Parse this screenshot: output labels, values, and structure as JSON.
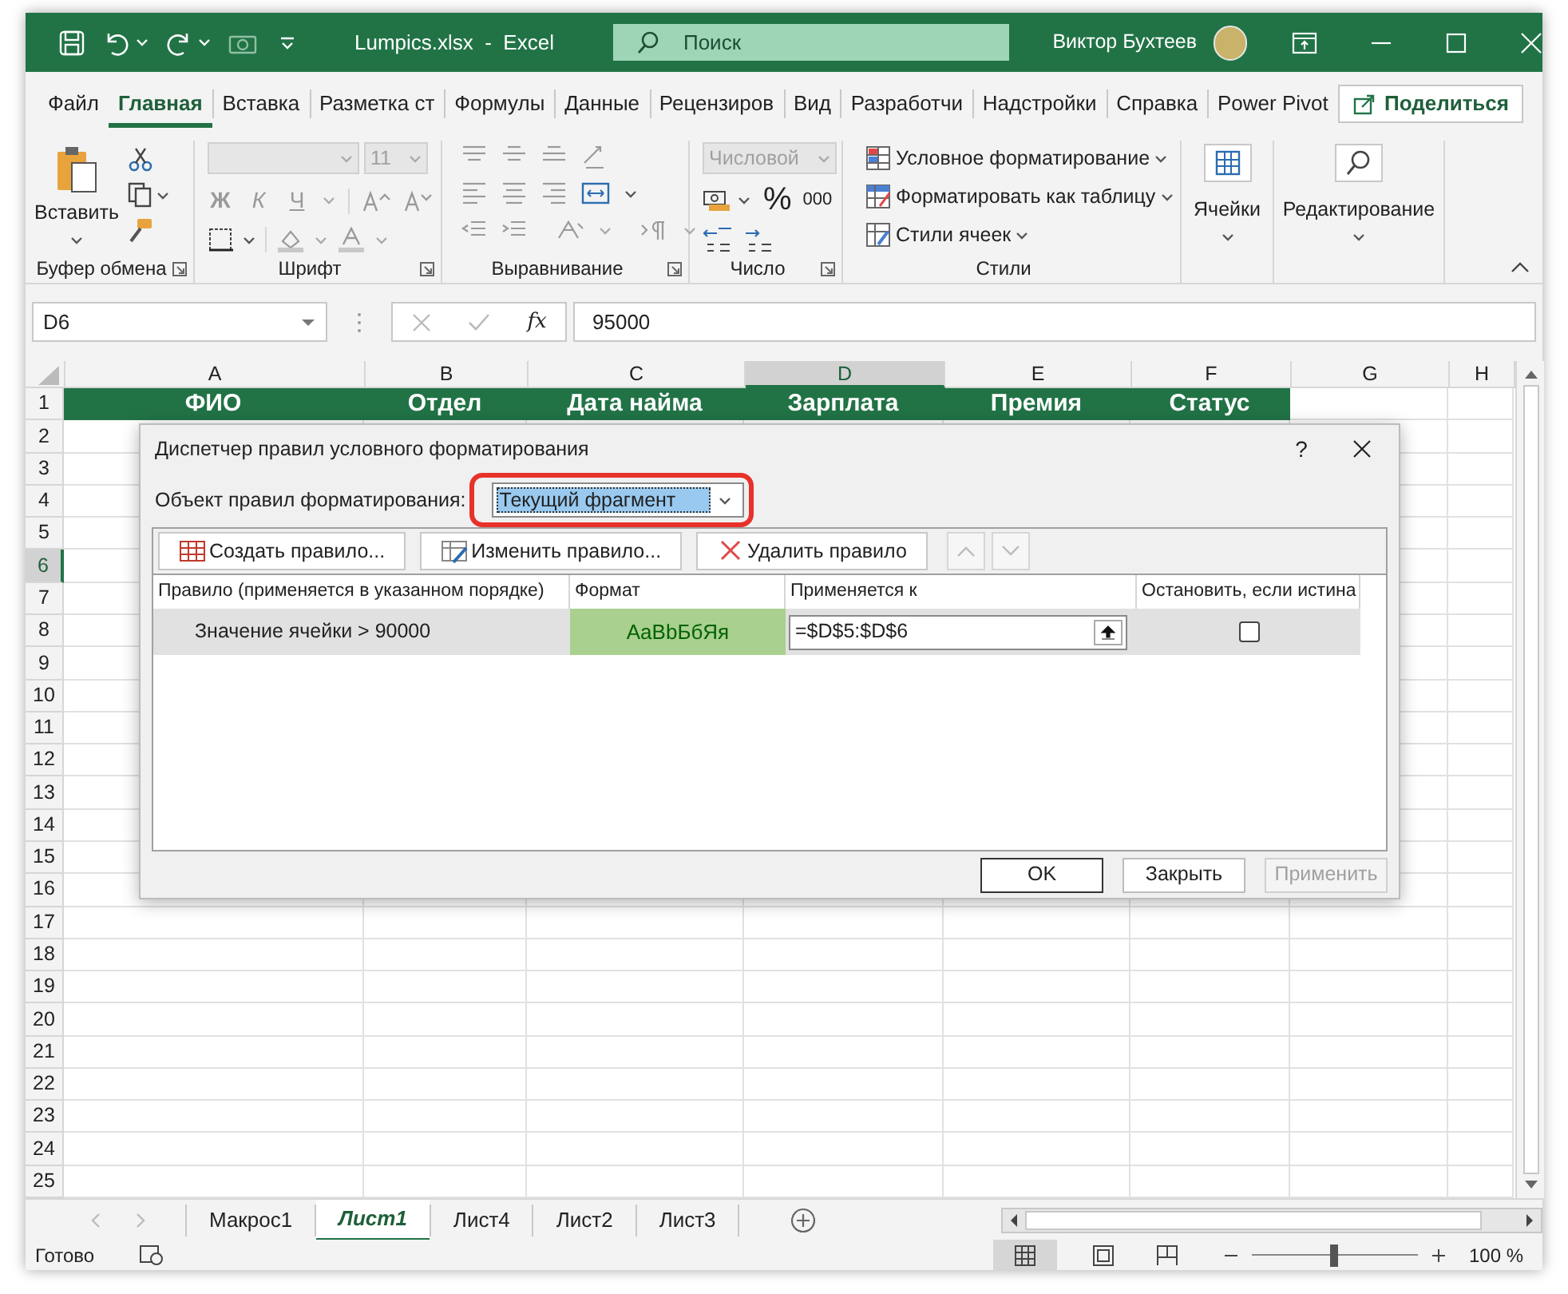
{
  "title_bar": {
    "file_title": "Lumpics.xlsx  -  Excel",
    "search_placeholder": "Поиск",
    "user": "Виктор Бухтеев"
  },
  "menu_tabs": [
    {
      "label": "Файл",
      "selected": false
    },
    {
      "label": "Главная",
      "selected": true
    },
    {
      "label": "Вставка",
      "selected": false
    },
    {
      "label": "Разметка ст",
      "selected": false
    },
    {
      "label": "Формулы",
      "selected": false
    },
    {
      "label": "Данные",
      "selected": false
    },
    {
      "label": "Рецензиров",
      "selected": false
    },
    {
      "label": "Вид",
      "selected": false
    },
    {
      "label": "Разработчи",
      "selected": false
    },
    {
      "label": "Надстройки",
      "selected": false
    },
    {
      "label": "Справка",
      "selected": false
    },
    {
      "label": "Power Pivot",
      "selected": false
    }
  ],
  "share_button": "Поделиться",
  "ribbon": {
    "paste": "Вставить",
    "font_size": "11",
    "font_buttons": [
      "Ж",
      "К",
      "Ч"
    ],
    "number_format": "Числовой",
    "percent": "%",
    "thousands": "000",
    "styles": [
      "Условное форматирование",
      "Форматировать как таблицу",
      "Стили ячеек"
    ],
    "cells": "Ячейки",
    "editing": "Редактирование",
    "groups": [
      "Буфер обмена",
      "Шрифт",
      "Выравнивание",
      "Число",
      "Стили"
    ]
  },
  "formula_bar": {
    "name_box": "D6",
    "fx": "fx",
    "value": "95000"
  },
  "sheet": {
    "columns": [
      {
        "label": "A",
        "selected": false
      },
      {
        "label": "B",
        "selected": false
      },
      {
        "label": "C",
        "selected": false
      },
      {
        "label": "D",
        "selected": true
      },
      {
        "label": "E",
        "selected": false
      },
      {
        "label": "F",
        "selected": false
      },
      {
        "label": "G",
        "selected": false
      },
      {
        "label": "H",
        "selected": false
      }
    ],
    "header_row": [
      "ФИО",
      "Отдел",
      "Дата найма",
      "Зарплата",
      "Премия",
      "Статус"
    ],
    "rows": [
      {
        "label": "1",
        "selected": false
      },
      {
        "label": "2",
        "selected": false
      },
      {
        "label": "3",
        "selected": false
      },
      {
        "label": "4",
        "selected": false
      },
      {
        "label": "5",
        "selected": false
      },
      {
        "label": "6",
        "selected": true
      },
      {
        "label": "7",
        "selected": false
      },
      {
        "label": "8",
        "selected": false
      },
      {
        "label": "9",
        "selected": false
      },
      {
        "label": "10",
        "selected": false
      },
      {
        "label": "11",
        "selected": false
      },
      {
        "label": "12",
        "selected": false
      },
      {
        "label": "13",
        "selected": false
      },
      {
        "label": "14",
        "selected": false
      },
      {
        "label": "15",
        "selected": false
      },
      {
        "label": "16",
        "selected": false
      },
      {
        "label": "17",
        "selected": false
      },
      {
        "label": "18",
        "selected": false
      },
      {
        "label": "19",
        "selected": false
      },
      {
        "label": "20",
        "selected": false
      },
      {
        "label": "21",
        "selected": false
      },
      {
        "label": "22",
        "selected": false
      },
      {
        "label": "23",
        "selected": false
      },
      {
        "label": "24",
        "selected": false
      },
      {
        "label": "25",
        "selected": false
      }
    ]
  },
  "dialog": {
    "title": "Диспетчер правил условного форматирования",
    "help": "?",
    "scope_label": "Объект правил форматирования:",
    "scope_value": "Текущий фрагмент",
    "buttons": [
      {
        "label": "Создать правило...",
        "kind": "new"
      },
      {
        "label": "Изменить правило...",
        "kind": "edit"
      },
      {
        "label": "Удалить правило",
        "kind": "delete"
      }
    ],
    "columns": [
      "Правило (применяется в указанном порядке)",
      "Формат",
      "Применяется к",
      "Остановить, если истина"
    ],
    "rules": [
      {
        "rule": "Значение ячейки > 90000",
        "preview": "AaBbБбЯя",
        "applies_to": "=$D$5:$D$6",
        "stop": false,
        "selected": true
      }
    ],
    "footer": [
      {
        "label": "OK",
        "disabled": false
      },
      {
        "label": "Закрыть",
        "disabled": false
      },
      {
        "label": "Применить",
        "disabled": true
      }
    ]
  },
  "sheet_tabs": [
    {
      "label": "Макрос1",
      "selected": false
    },
    {
      "label": "Лист1",
      "selected": true
    },
    {
      "label": "Лист4",
      "selected": false
    },
    {
      "label": "Лист2",
      "selected": false
    },
    {
      "label": "Лист3",
      "selected": false
    }
  ],
  "status_bar": {
    "status": "Готово",
    "zoom": "100 %",
    "zoom_slider": {
      "level": 0.5
    }
  }
}
